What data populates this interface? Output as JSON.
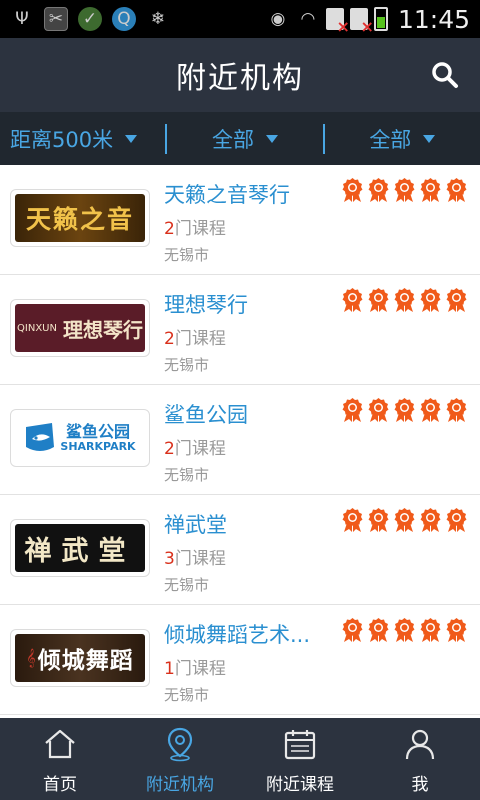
{
  "status_bar": {
    "time": "11:45"
  },
  "header": {
    "title": "附近机构"
  },
  "filters": {
    "distance": "距离500米",
    "category": "全部",
    "sort": "全部"
  },
  "institutions": [
    {
      "name": "天籁之音琴行",
      "course_count": "2",
      "course_unit": "门课程",
      "city": "无锡市",
      "rating": 5,
      "logo_text": "天籁之音"
    },
    {
      "name": "理想琴行",
      "course_count": "2",
      "course_unit": "门课程",
      "city": "无锡市",
      "rating": 5,
      "logo_text": "理想琴行",
      "logo_subtext": "QINXUN"
    },
    {
      "name": "鲨鱼公园",
      "course_count": "2",
      "course_unit": "门课程",
      "city": "无锡市",
      "rating": 5,
      "logo_text": "鲨鱼公园",
      "logo_subtext": "SHARKPARK"
    },
    {
      "name": "禅武堂",
      "course_count": "3",
      "course_unit": "门课程",
      "city": "无锡市",
      "rating": 5,
      "logo_text": "禅武堂"
    },
    {
      "name": "倾城舞蹈艺术...",
      "course_count": "1",
      "course_unit": "门课程",
      "city": "无锡市",
      "rating": 5,
      "logo_text": "倾城舞蹈"
    }
  ],
  "bottom_nav": [
    {
      "label": "首页",
      "icon": "home-icon",
      "active": false
    },
    {
      "label": "附近机构",
      "icon": "location-pin-icon",
      "active": true
    },
    {
      "label": "附近课程",
      "icon": "calendar-icon",
      "active": false
    },
    {
      "label": "我",
      "icon": "user-icon",
      "active": false
    }
  ],
  "colors": {
    "accent": "#49a6e3",
    "header_bg": "#2c333f",
    "filter_bg": "#20272f",
    "medal": "#f05a1a",
    "count": "#d9301b"
  }
}
